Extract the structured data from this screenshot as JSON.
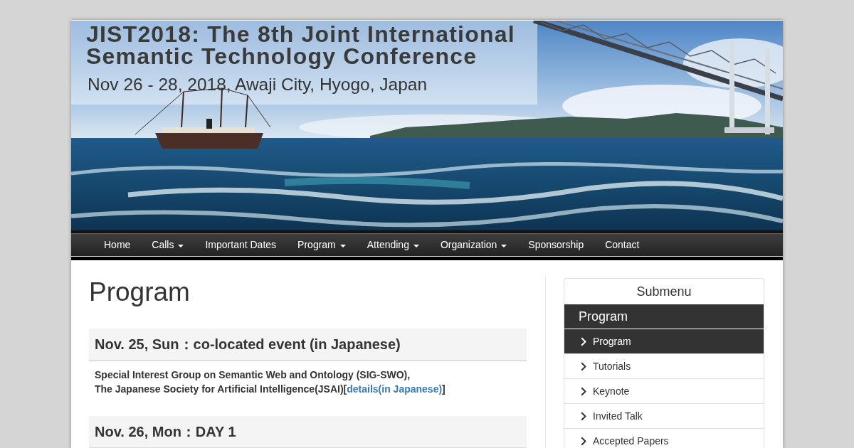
{
  "banner": {
    "title_lines": [
      "JIST2018: The 8th Joint International",
      "Semantic Technology Conference"
    ],
    "subtitle": "Nov 26 - 28, 2018, Awaji City, Hyogo, Japan"
  },
  "navbar": {
    "items": [
      {
        "label": "Home",
        "dropdown": false
      },
      {
        "label": "Calls",
        "dropdown": true
      },
      {
        "label": "Important Dates",
        "dropdown": false
      },
      {
        "label": "Program",
        "dropdown": true
      },
      {
        "label": "Attending",
        "dropdown": true
      },
      {
        "label": "Organization",
        "dropdown": true
      },
      {
        "label": "Sponsorship",
        "dropdown": false
      },
      {
        "label": "Contact",
        "dropdown": false
      }
    ]
  },
  "main": {
    "title": "Program",
    "sections": [
      {
        "heading": "Nov. 25, Sun：co-located event (in Japanese)",
        "paragraph": [
          {
            "kind": "text",
            "text": "Special Interest Group on Semantic Web and Ontology (SIG-SWO),"
          },
          {
            "kind": "linebreak"
          },
          {
            "kind": "text",
            "text": "The Japanese Society for Artificial Intelligence(JSAI)["
          },
          {
            "kind": "link",
            "text": "details(in Japanese)"
          },
          {
            "kind": "text",
            "text": "]"
          }
        ]
      },
      {
        "heading": "Nov. 26, Mon：DAY 1"
      }
    ]
  },
  "sidebar": {
    "title": "Submenu",
    "group": "Program",
    "items": [
      {
        "label": "Program",
        "selected": true
      },
      {
        "label": "Tutorials",
        "selected": false
      },
      {
        "label": "Keynote",
        "selected": false
      },
      {
        "label": "Invited Talk",
        "selected": false
      },
      {
        "label": "Accepted Papers",
        "selected": false
      }
    ]
  }
}
